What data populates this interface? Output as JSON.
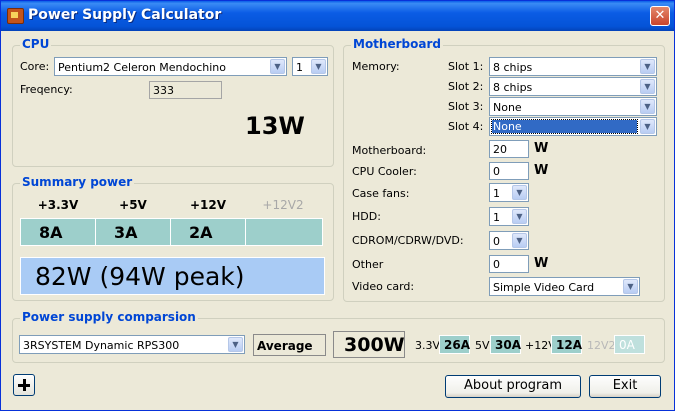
{
  "window": {
    "title": "Power Supply Calculator",
    "close_glyph": "✕"
  },
  "cpu": {
    "title": "CPU",
    "core_label": "Core:",
    "core_value": "Pentium2 Celeron Mendochino",
    "count_value": "1",
    "frequency_label": "Freqency:",
    "frequency_value": "333",
    "watts": "13W"
  },
  "summary": {
    "title": "Summary power",
    "rails": [
      {
        "label": "+3.3V",
        "amps": "8A",
        "enabled": true
      },
      {
        "label": "+5V",
        "amps": "3A",
        "enabled": true
      },
      {
        "label": "+12V",
        "amps": "2A",
        "enabled": true
      },
      {
        "label": "+12V2",
        "amps": "",
        "enabled": false
      }
    ],
    "total": "82W (94W peak)"
  },
  "motherboard": {
    "title": "Motherboard",
    "memory_label": "Memory:",
    "slots": [
      {
        "label": "Slot 1:",
        "value": "8 chips"
      },
      {
        "label": "Slot 2:",
        "value": "8 chips"
      },
      {
        "label": "Slot 3:",
        "value": "None"
      },
      {
        "label": "Slot 4:",
        "value": "None"
      }
    ],
    "mb_label": "Motherboard:",
    "mb_value": "20",
    "cooler_label": "CPU Cooler:",
    "cooler_value": "0",
    "fans_label": "Case fans:",
    "fans_value": "1",
    "hdd_label": "HDD:",
    "hdd_value": "1",
    "cdrom_label": "CDROM/CDRW/DVD:",
    "cdrom_value": "0",
    "other_label": "Other",
    "other_value": "0",
    "video_label": "Video card:",
    "video_value": "Simple Video Card",
    "unit": "W"
  },
  "comparison": {
    "title": "Power supply comparsion",
    "model_value": "3RSYSTEM Dynamic RPS300",
    "rating": "Average",
    "watts": "300W",
    "rails": [
      {
        "label": "3.3V",
        "amps": "26A",
        "enabled": true
      },
      {
        "label": "5V",
        "amps": "30A",
        "enabled": true
      },
      {
        "label": "+12V",
        "amps": "12A",
        "enabled": true
      },
      {
        "label": "12V2",
        "amps": "0A",
        "enabled": false
      }
    ]
  },
  "buttons": {
    "about": "About program",
    "exit": "Exit"
  },
  "colors": {
    "title_blue": "#0046d5",
    "amp_cell": "#9dcfcb",
    "total_cell": "#a9cbf5",
    "selection": "#316ac5"
  },
  "icons": {
    "arrow": "▼"
  }
}
